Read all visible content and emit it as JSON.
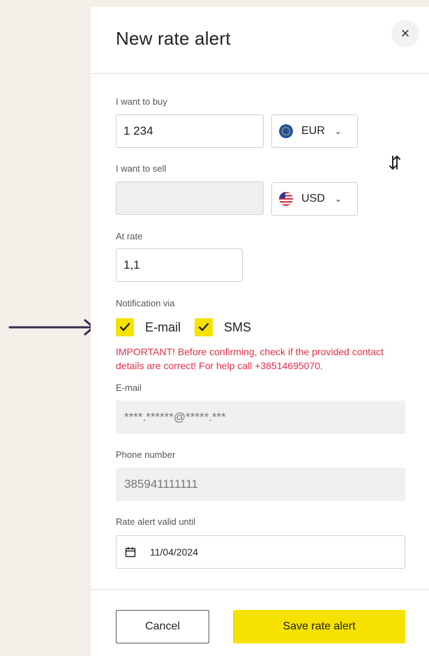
{
  "dialog": {
    "title": "New rate alert",
    "close_symbol": "×"
  },
  "buy": {
    "label": "I want to buy",
    "amount": "1 234",
    "currency": "EUR",
    "currency_flag": "eu-flag-icon"
  },
  "sell": {
    "label": "I want to sell",
    "amount": "",
    "currency": "USD",
    "currency_flag": "us-flag-icon"
  },
  "swap_icon": "swap-arrows-icon",
  "rate": {
    "label": "At rate",
    "value": "1,1"
  },
  "notification": {
    "label": "Notification via",
    "email_label": "E-mail",
    "email_checked": true,
    "sms_label": "SMS",
    "sms_checked": true,
    "warning": "IMPORTANT! Before confirming, check if the provided contact details are correct! For help call +38514695070."
  },
  "email": {
    "label": "E-mail",
    "value": "****.******@*****.***"
  },
  "phone": {
    "label": "Phone number",
    "value": "385941111111"
  },
  "valid_until": {
    "label": "Rate alert valid until",
    "value": "11/04/2024",
    "icon": "calendar-icon"
  },
  "footer": {
    "cancel_label": "Cancel",
    "save_label": "Save rate alert"
  },
  "colors": {
    "accent": "#f5e200",
    "warning": "#e0304a",
    "background": "#f3efe9",
    "annotation_arrow": "#3b2a4e"
  }
}
